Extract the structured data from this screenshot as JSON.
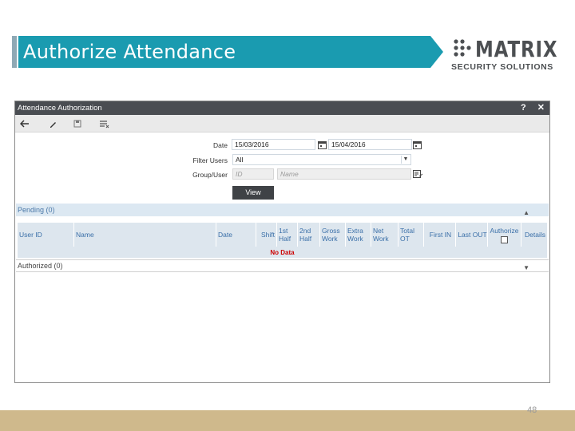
{
  "slide": {
    "title": "Authorize Attendance",
    "page_number": "48"
  },
  "logo": {
    "word": "MATRIX",
    "subtitle": "SECURITY SOLUTIONS"
  },
  "window": {
    "title": "Attendance Authorization",
    "help": "?",
    "close": "✕"
  },
  "toolbar": {
    "back_icon": "back-arrow-icon",
    "edit_icon": "pencil-icon",
    "save_icon": "save-icon",
    "clear_icon": "clear-filter-icon"
  },
  "form": {
    "date_label": "Date",
    "date_from": "15/03/2016",
    "date_to": "15/04/2016",
    "filter_label": "Filter Users",
    "filter_value": "All",
    "group_label": "Group/User",
    "id_placeholder": "ID",
    "name_placeholder": "Name",
    "view_button": "View"
  },
  "pending": {
    "label": "Pending (0)",
    "columns": [
      "User ID",
      "Name",
      "Date",
      "Shift",
      "1st Half",
      "2nd Half",
      "Gross Work",
      "Extra Work",
      "Net Work",
      "Total OT",
      "First IN",
      "Last OUT",
      "Authorize",
      "Details"
    ],
    "empty_text": "No Data"
  },
  "authorized": {
    "label": "Authorized (0)"
  },
  "colors": {
    "banner": "#1a9bb0",
    "window_title": "#4a4d52",
    "accent_text": "#3a6fa8",
    "no_data": "#cc0000",
    "bottom_strip": "#cfb98c"
  }
}
